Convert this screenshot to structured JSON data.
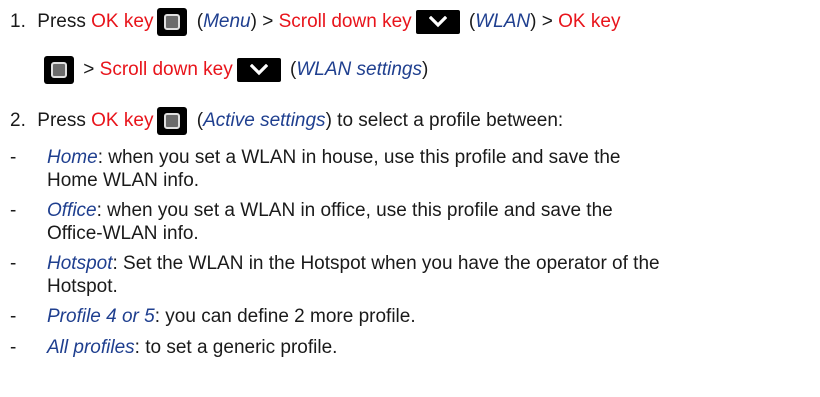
{
  "steps": [
    {
      "number": "1.",
      "press": "Press",
      "ok_key": "OK key",
      "open_paren": "(",
      "menu": "Menu",
      "gt": ") >",
      "scroll_down_key": "Scroll down key",
      "wlan": "WLAN",
      "gt2": ") >",
      "ok_key2": "OK key",
      "gt3": ">",
      "scroll_down_key2": "Scroll down key",
      "wlan_settings": "WLAN settings",
      "close_paren": ")"
    },
    {
      "number": "2.",
      "press": "Press",
      "ok_key": "OK key",
      "open_paren": "(",
      "active_settings": "Active settings",
      "rest": ") to select a profile between:"
    }
  ],
  "profiles": [
    {
      "name": "Home",
      "line1": ": when you set a WLAN in house, use this profile and save the",
      "line2": "Home WLAN info."
    },
    {
      "name": "Office",
      "line1": ": when you set a WLAN in office, use this profile and save the",
      "line2": "Office-WLAN info."
    },
    {
      "name": "Hotspot",
      "line1": ": Set the WLAN in the Hotspot when you have the operator of the",
      "line2": "Hotspot."
    },
    {
      "name": "Profile 4 or 5",
      "line1": ": you can define 2 more profile."
    },
    {
      "name": "All profiles",
      "line1": ": to set a generic profile."
    }
  ],
  "dash": "-",
  "icons": {
    "ok_key": "ok-key-icon",
    "scroll_down_key": "chevron-down-icon"
  },
  "colors": {
    "key_text": "#e8141b",
    "italic_text": "#1f3f8f",
    "body_text": "#1a1a1a"
  }
}
